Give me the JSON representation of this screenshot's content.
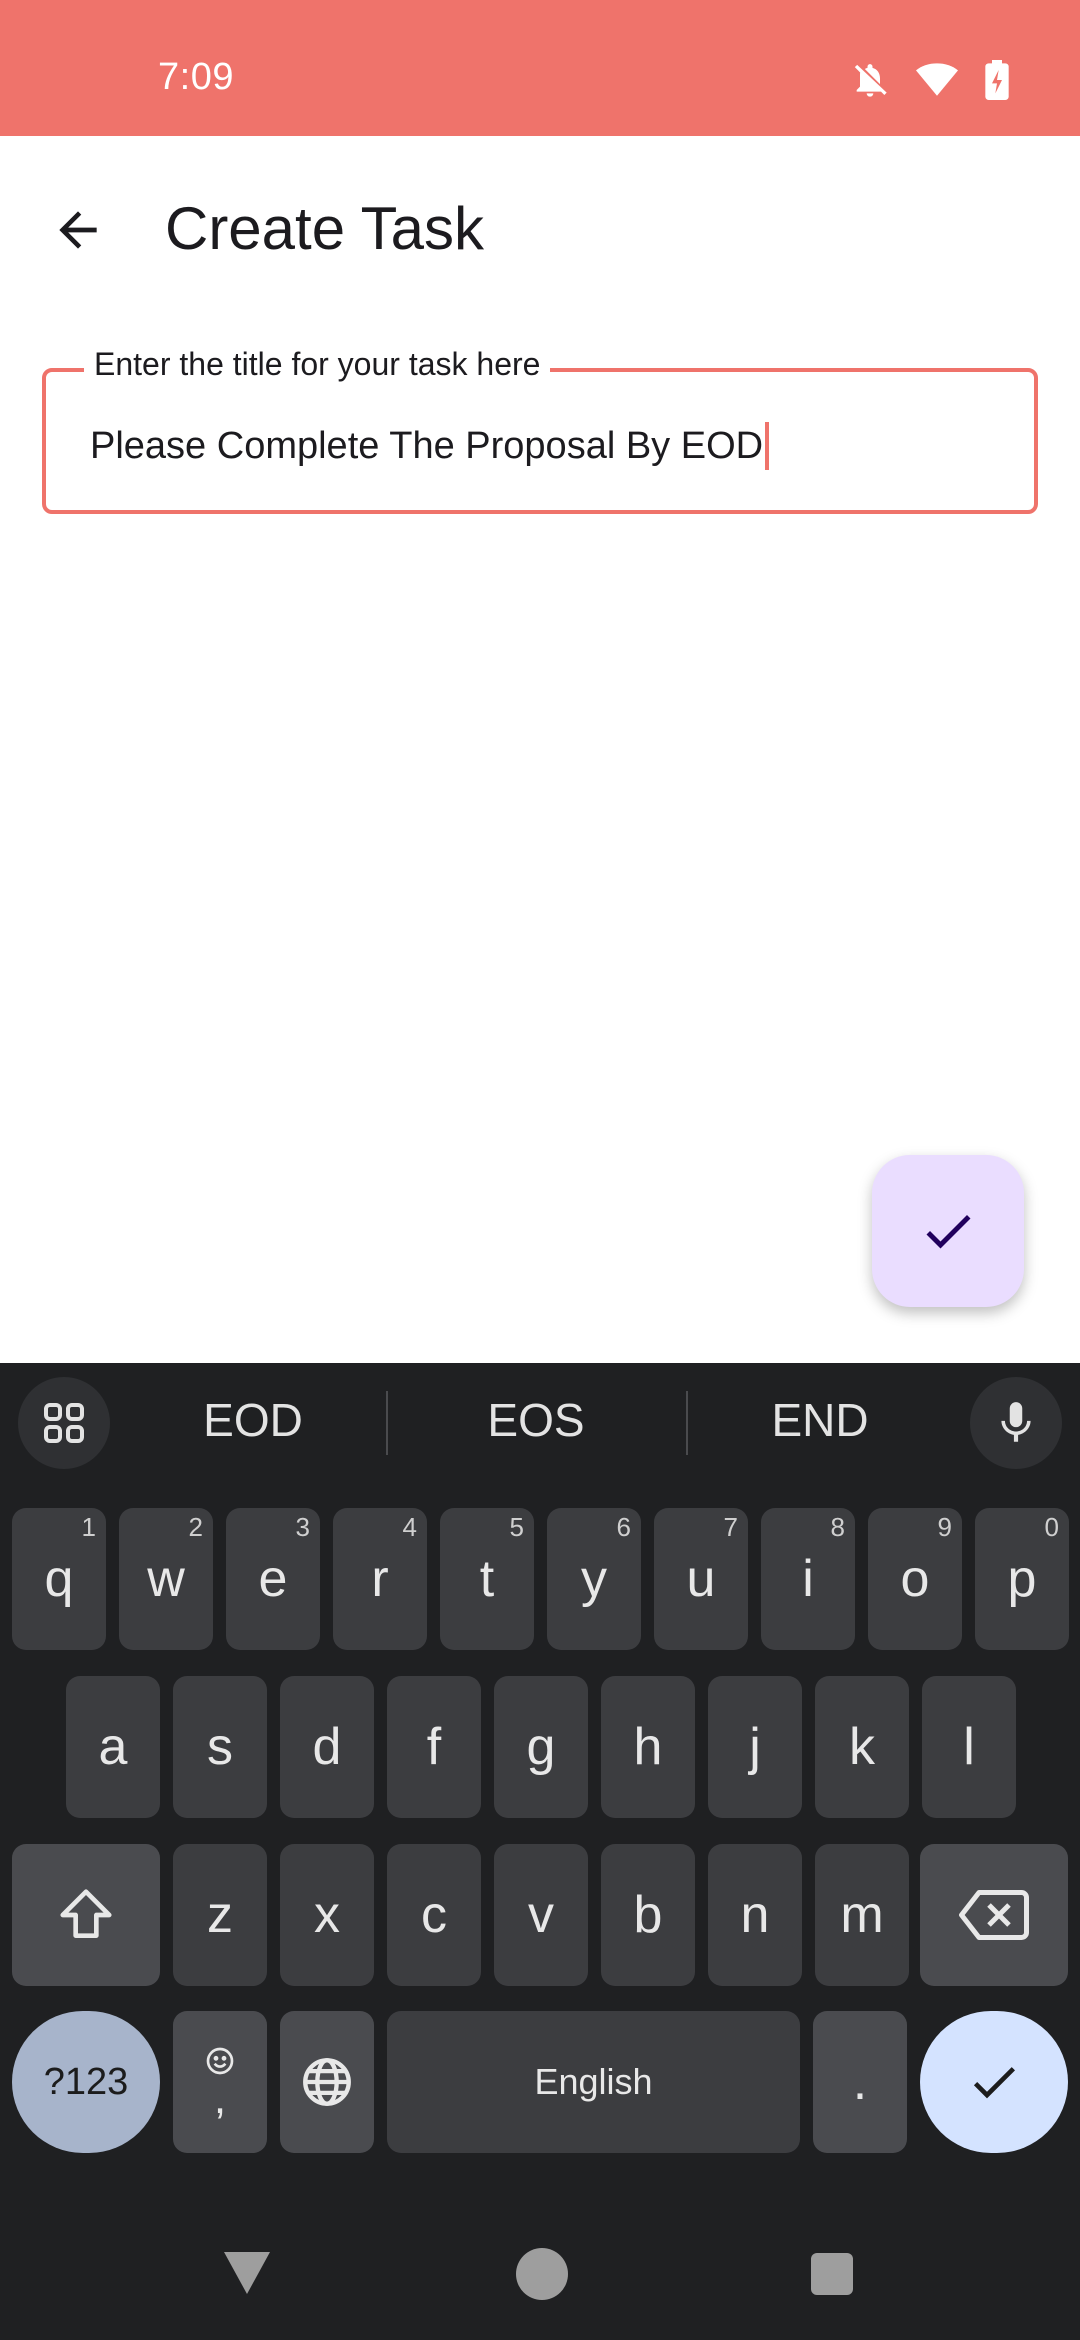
{
  "status_bar": {
    "time": "7:09",
    "icons": [
      "notifications-off-icon",
      "wifi-icon",
      "battery-charging-icon"
    ],
    "background": "#EF736B"
  },
  "app_bar": {
    "back_icon": "arrow-back-icon",
    "title": "Create Task"
  },
  "title_field": {
    "label": "Enter the title for your task here",
    "value": "Please Complete The Proposal By EOD",
    "accent": "#EF736B"
  },
  "fab": {
    "icon": "check-icon",
    "background": "#EADDFF"
  },
  "keyboard": {
    "suggestions": [
      "EOD",
      "EOS",
      "END"
    ],
    "row1": [
      {
        "key": "q",
        "hint": "1"
      },
      {
        "key": "w",
        "hint": "2"
      },
      {
        "key": "e",
        "hint": "3"
      },
      {
        "key": "r",
        "hint": "4"
      },
      {
        "key": "t",
        "hint": "5"
      },
      {
        "key": "y",
        "hint": "6"
      },
      {
        "key": "u",
        "hint": "7"
      },
      {
        "key": "i",
        "hint": "8"
      },
      {
        "key": "o",
        "hint": "9"
      },
      {
        "key": "p",
        "hint": "0"
      }
    ],
    "row2": [
      "a",
      "s",
      "d",
      "f",
      "g",
      "h",
      "j",
      "k",
      "l"
    ],
    "row3": [
      "z",
      "x",
      "c",
      "v",
      "b",
      "n",
      "m"
    ],
    "symbols_label": "?123",
    "comma_label": ",",
    "space_label": "English",
    "period_label": ".",
    "icons": [
      "apps-grid-icon",
      "microphone-icon",
      "shift-icon",
      "backspace-icon",
      "emoji-icon",
      "globe-icon",
      "enter-check-icon"
    ]
  },
  "nav_bar": {
    "icons": [
      "nav-back-icon",
      "nav-home-icon",
      "nav-recents-icon"
    ]
  }
}
